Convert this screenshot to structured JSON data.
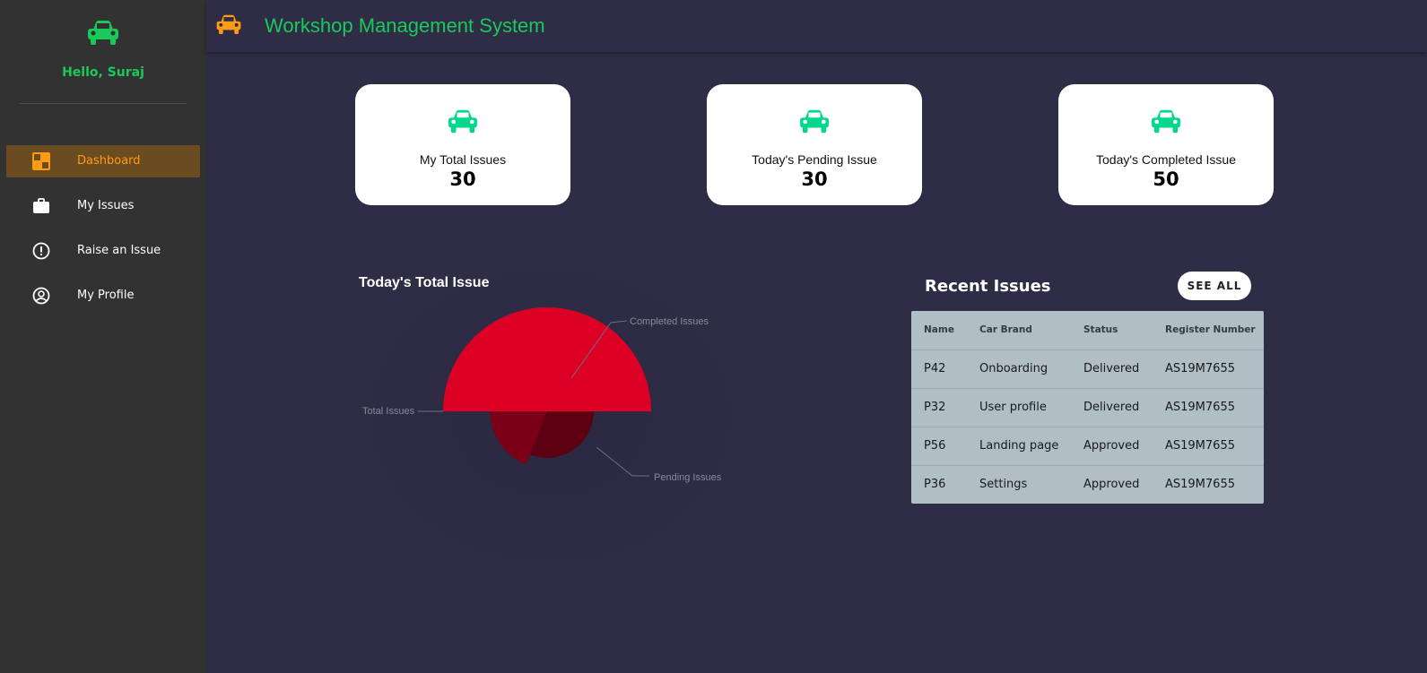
{
  "sidebar": {
    "greeting": "Hello, Suraj",
    "logo_icon": "car-icon",
    "items": [
      {
        "label": "Dashboard",
        "icon": "dashboard-icon",
        "active": true
      },
      {
        "label": "My Issues",
        "icon": "briefcase-icon",
        "active": false
      },
      {
        "label": "Raise an Issue",
        "icon": "alert-circle-icon",
        "active": false
      },
      {
        "label": "My Profile",
        "icon": "user-circle-icon",
        "active": false
      }
    ]
  },
  "header": {
    "title": "Workshop Management System",
    "logo_icon": "car-icon"
  },
  "cards": [
    {
      "label": "My Total Issues",
      "value": "30",
      "icon": "car-icon"
    },
    {
      "label": "Today's Pending Issue",
      "value": "30",
      "icon": "car-icon"
    },
    {
      "label": "Today's Completed Issue",
      "value": "50",
      "icon": "car-icon"
    }
  ],
  "chart_data": {
    "type": "pie",
    "title": "Today's Total Issue",
    "categories": [
      "Total Issues",
      "Completed Issues",
      "Pending Issues"
    ],
    "values": [
      50,
      10,
      15
    ],
    "colors": [
      "#dc0024",
      "#5c0012",
      "#7b0017"
    ]
  },
  "recent": {
    "title": "Recent Issues",
    "see_all_label": "SEE ALL",
    "columns": [
      "Name",
      "Car Brand",
      "Status",
      "Register Number"
    ],
    "rows": [
      [
        "P42",
        "Onboarding",
        "Delivered",
        "AS19M7655"
      ],
      [
        "P32",
        "User profile",
        "Delivered",
        "AS19M7655"
      ],
      [
        "P56",
        "Landing page",
        "Approved",
        "AS19M7655"
      ],
      [
        "P36",
        "Settings",
        "Approved",
        "AS19M7655"
      ]
    ]
  },
  "colors": {
    "accent_green": "#19c95a",
    "accent_orange": "#ff9a15",
    "card_icon": "#00d98b",
    "background": "#2f2d45",
    "sidebar": "#333232"
  }
}
